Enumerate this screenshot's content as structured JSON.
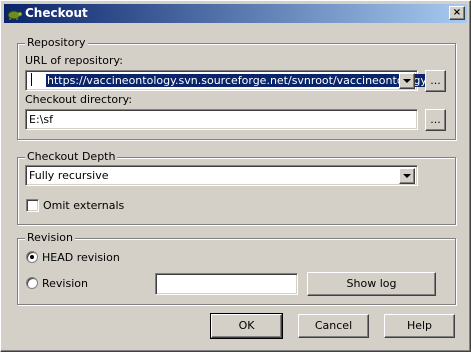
{
  "window": {
    "title": "Checkout",
    "close_label": "×"
  },
  "repository_group": {
    "label": "Repository",
    "url_label": "URL of repository:",
    "url_value": "https://vaccineontology.svn.sourceforge.net/svnroot/vaccineontology",
    "browse_label": "...",
    "dir_label": "Checkout directory:",
    "dir_value": "E:\\sf",
    "dir_browse_label": "..."
  },
  "depth_group": {
    "label": "Checkout Depth",
    "depth_value": "Fully recursive",
    "omit_externals_label": "Omit externals",
    "omit_externals_checked": false
  },
  "revision_group": {
    "label": "Revision",
    "head_label": "HEAD revision",
    "head_selected": true,
    "revision_label": "Revision",
    "revision_value": "",
    "show_log_label": "Show log"
  },
  "buttons": {
    "ok": "OK",
    "cancel": "Cancel",
    "help": "Help"
  },
  "colors": {
    "titlebar_start": "#0a246a",
    "titlebar_end": "#a6caf0",
    "face": "#d4d0c8",
    "selection": "#0a246a"
  }
}
